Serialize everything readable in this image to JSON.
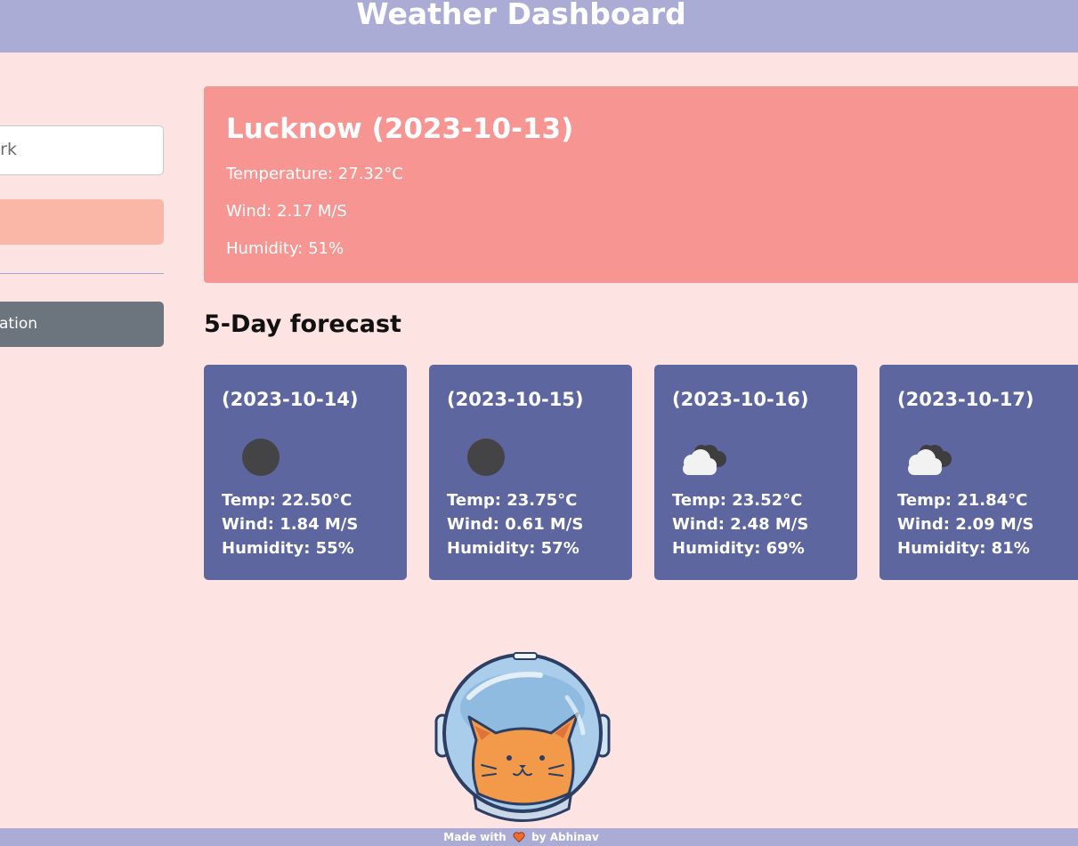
{
  "header": {
    "title": "Weather Dashboard"
  },
  "sidebar": {
    "search_input_value": "ork",
    "search_button_label": "",
    "location_button_label": "ation"
  },
  "current": {
    "title": "Lucknow (2023-10-13)",
    "temperature": "Temperature: 27.32°C",
    "wind": "Wind: 2.17 M/S",
    "humidity": "Humidity: 51%"
  },
  "forecast": {
    "heading": "5-Day forecast",
    "days": [
      {
        "date": "(2023-10-14)",
        "icon": "moon-icon",
        "temp": "Temp: 22.50°C",
        "wind": "Wind: 1.84 M/S",
        "humidity": "Humidity: 55%"
      },
      {
        "date": "(2023-10-15)",
        "icon": "moon-icon",
        "temp": "Temp: 23.75°C",
        "wind": "Wind: 0.61 M/S",
        "humidity": "Humidity: 57%"
      },
      {
        "date": "(2023-10-16)",
        "icon": "clouds-icon",
        "temp": "Temp: 23.52°C",
        "wind": "Wind: 2.48 M/S",
        "humidity": "Humidity: 69%"
      },
      {
        "date": "(2023-10-17)",
        "icon": "clouds-icon",
        "temp": "Temp: 21.84°C",
        "wind": "Wind: 2.09 M/S",
        "humidity": "Humidity: 81%"
      }
    ]
  },
  "footer": {
    "made_with": "Made with",
    "by": "by Abhinav"
  },
  "colors": {
    "header_bg": "#aaacd6",
    "page_bg": "#fde3e1",
    "current_card_bg": "#f69591",
    "forecast_card_bg": "#5d669e",
    "search_button_bg": "#fab6a6",
    "location_button_bg": "#6c757d",
    "heart": "#f26b2a"
  }
}
